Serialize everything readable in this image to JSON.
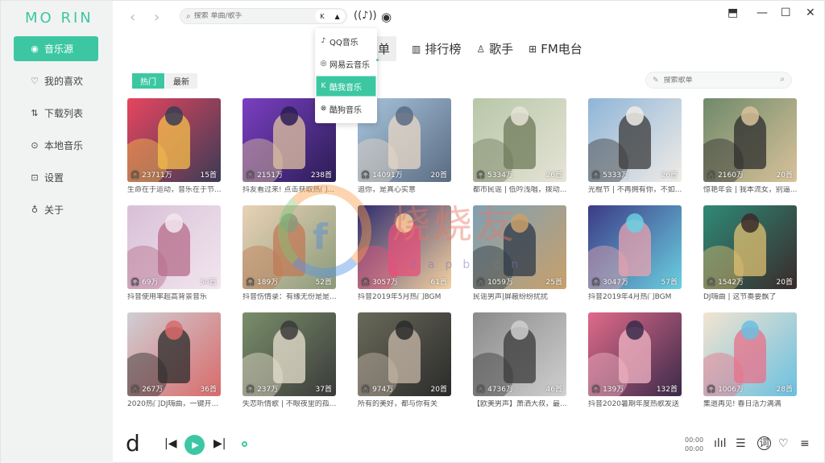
{
  "app": {
    "logo_a": "MO",
    "logo_b": "RIN",
    "accent": "#3cc7a2"
  },
  "sidebar": {
    "items": [
      {
        "label": "音乐源",
        "icon": "music-source-icon",
        "active": true
      },
      {
        "label": "我的喜欢",
        "icon": "heart-icon"
      },
      {
        "label": "下载列表",
        "icon": "download-icon"
      },
      {
        "label": "本地音乐",
        "icon": "local-music-icon"
      },
      {
        "label": "设置",
        "icon": "settings-icon"
      },
      {
        "label": "关于",
        "icon": "about-icon"
      }
    ]
  },
  "search": {
    "placeholder": "搜索 单曲/歌手"
  },
  "source_dropdown": {
    "items": [
      {
        "label": "QQ音乐",
        "icon": "qq-music-icon"
      },
      {
        "label": "网易云音乐",
        "icon": "netease-icon"
      },
      {
        "label": "酷我音乐",
        "icon": "kuwo-icon",
        "active": true
      },
      {
        "label": "酷狗音乐",
        "icon": "kugou-icon"
      }
    ]
  },
  "tabs": [
    {
      "label": "单",
      "active": true
    },
    {
      "label": "排行榜",
      "icon": "chart-icon"
    },
    {
      "label": "歌手",
      "icon": "singer-icon"
    },
    {
      "label": "FM电台",
      "icon": "radio-icon"
    }
  ],
  "subtabs": [
    {
      "label": "热门",
      "active": true
    },
    {
      "label": "最新"
    }
  ],
  "list_search": {
    "placeholder": "搜索歌单"
  },
  "playlists": [
    {
      "plays": "23711万",
      "count": "15首",
      "title": "生命在于运动，音乐在于节..."
    },
    {
      "plays": "2151万",
      "count": "238首",
      "title": "抖友看过来! 点击获取热门..."
    },
    {
      "plays": "14091万",
      "count": "20首",
      "title": "追你，是真心实意"
    },
    {
      "plays": "5334万",
      "count": "26首",
      "title": "都市民谣 | 低吟浅唱，拨动..."
    },
    {
      "plays": "5333万",
      "count": "26首",
      "title": "光棍节 | 不再拥有你，不如..."
    },
    {
      "plays": "2160万",
      "count": "20首",
      "title": "惊艳年会 | 我本流女，别逼..."
    },
    {
      "plays": "69万",
      "count": "54首",
      "title": "抖音使用率超高背景音乐"
    },
    {
      "plays": "189万",
      "count": "52首",
      "title": "抖音伤情录：有缘无份是是..."
    },
    {
      "plays": "3057万",
      "count": "61首",
      "title": "抖音2019年5月热门BGM"
    },
    {
      "plays": "1059万",
      "count": "25首",
      "title": "民谣男声|屏蔽纷纷扰扰"
    },
    {
      "plays": "3047万",
      "count": "57首",
      "title": "抖音2019年4月热门BGM"
    },
    {
      "plays": "1542万",
      "count": "20首",
      "title": "DJ嗨曲 | 这节奏要飘了"
    },
    {
      "plays": "267万",
      "count": "36首",
      "title": "2020热门DJ嗨曲，一键开..."
    },
    {
      "plays": "237万",
      "count": "37首",
      "title": "失恋听情歌 | 不眼夜里的孤..."
    },
    {
      "plays": "974万",
      "count": "20首",
      "title": "所有的美好，都与你有关"
    },
    {
      "plays": "4736万",
      "count": "46首",
      "title": "【欧美男声】萧洒大叔，最..."
    },
    {
      "plays": "139万",
      "count": "132首",
      "title": "抖音2020暑期年度热歌发送"
    },
    {
      "plays": "1006万",
      "count": "28首",
      "title": "集遗再见! 春日活力满满"
    }
  ],
  "watermark": {
    "text": "烧烧友",
    "sub": "2apb.cn"
  },
  "player": {
    "logo": "d",
    "time_current": "00:00",
    "time_total": "00:00"
  }
}
